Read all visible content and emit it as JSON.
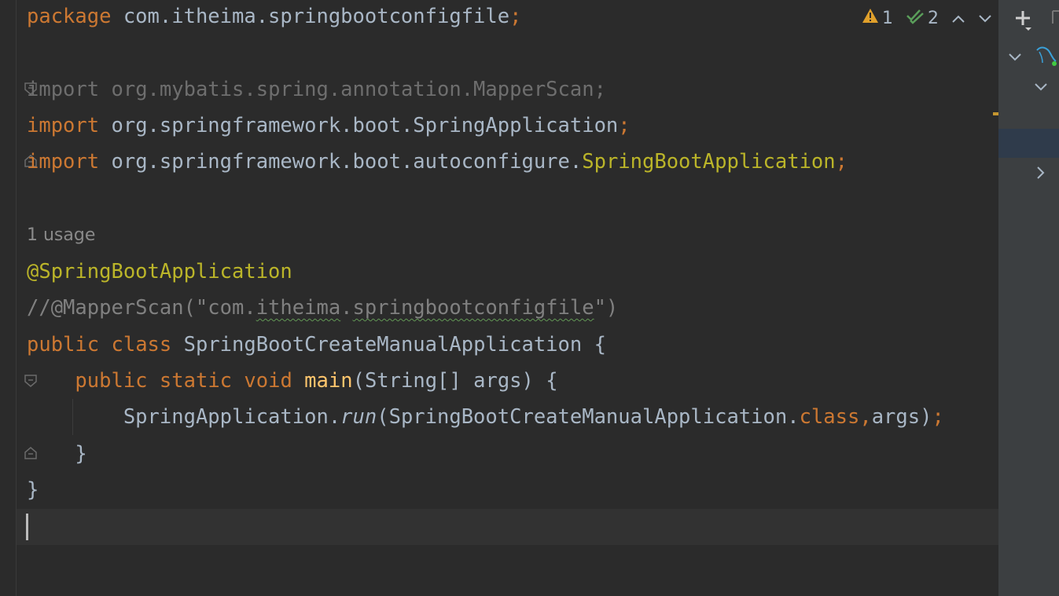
{
  "editor": {
    "lines": {
      "package_kw": "package",
      "package_name": "com.itheima.springbootconfigfile",
      "package_semi": ";",
      "import1_kw": "import",
      "import1_path": "org.mybatis.spring.annotation.MapperScan;",
      "import2_kw": "import",
      "import2_path": "org.springframework.boot.SpringApplication",
      "import2_semi": ";",
      "import3_kw": "import",
      "import3_path": "org.springframework.boot.autoconfigure.",
      "import3_class": "SpringBootApplication",
      "import3_semi": ";",
      "usage_hint": "1 usage",
      "annotation": "@SpringBootApplication",
      "comment_start": "//@MapperScan(\"com.",
      "comment_sq1": "itheima",
      "comment_dot": ".",
      "comment_sq2": "springbootconfigfile",
      "comment_end": "\")",
      "class_kw1": "public",
      "class_kw2": "class",
      "class_name": "SpringBootCreateManualApplication",
      "class_brace": "{",
      "main_kw1": "public",
      "main_kw2": "static",
      "main_kw3": "void",
      "main_name": "main",
      "main_params": "(String[] args) {",
      "run_target": "SpringApplication.",
      "run_method": "run",
      "run_arg": "(SpringBootCreateManualApplication.",
      "run_class_kw": "class,",
      "run_args": "args)",
      "run_semi": ";",
      "close_method": "}",
      "close_class": "}"
    }
  },
  "inspections": {
    "warnings_count": "1",
    "weak_warnings_count": "2",
    "warning_icon": "warning-triangle-icon",
    "check_icon": "double-check-icon",
    "warning_color": "#e0a02b",
    "check_color": "#5a9e5a"
  },
  "right_panel": {
    "add_icon": "plus-icon",
    "db_icon": "mysql-dolphin-icon"
  },
  "colors": {
    "background": "#2b2b2b",
    "keyword": "#cc7832",
    "annotation": "#bbb529",
    "comment": "#808080",
    "method": "#ffc66d",
    "text": "#a9b7c6"
  }
}
